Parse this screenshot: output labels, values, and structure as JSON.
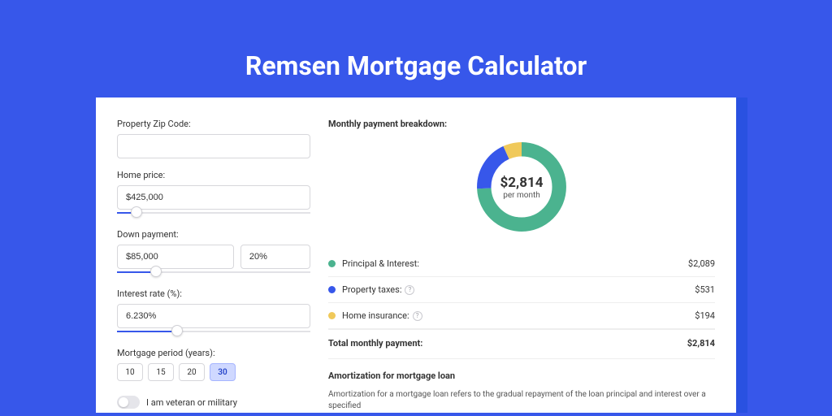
{
  "title": "Remsen Mortgage Calculator",
  "fields": {
    "zip": {
      "label": "Property Zip Code:",
      "value": ""
    },
    "price": {
      "label": "Home price:",
      "value": "$425,000",
      "slider_pct": 10
    },
    "down": {
      "label": "Down payment:",
      "value": "$85,000",
      "pct": "20%",
      "slider_pct": 20
    },
    "rate": {
      "label": "Interest rate (%):",
      "value": "6.230%",
      "slider_pct": 31
    },
    "period": {
      "label": "Mortgage period (years):",
      "options": [
        "10",
        "15",
        "20",
        "30"
      ],
      "selected": "30"
    },
    "military": {
      "label": "I am veteran or military"
    }
  },
  "breakdown": {
    "title": "Monthly payment breakdown:",
    "center_amount": "$2,814",
    "center_sub": "per month",
    "items": [
      {
        "label": "Principal & Interest:",
        "value": "$2,089",
        "color": "#4bb38f",
        "info": false
      },
      {
        "label": "Property taxes:",
        "value": "$531",
        "color": "#3757ea",
        "info": true
      },
      {
        "label": "Home insurance:",
        "value": "$194",
        "color": "#f0c95a",
        "info": true
      }
    ],
    "total": {
      "label": "Total monthly payment:",
      "value": "$2,814"
    }
  },
  "amort": {
    "title": "Amortization for mortgage loan",
    "text": "Amortization for a mortgage loan refers to the gradual repayment of the loan principal and interest over a specified"
  },
  "chart_data": {
    "type": "pie",
    "title": "Monthly payment breakdown",
    "series": [
      {
        "name": "Principal & Interest",
        "value": 2089,
        "color": "#4bb38f"
      },
      {
        "name": "Property taxes",
        "value": 531,
        "color": "#3757ea"
      },
      {
        "name": "Home insurance",
        "value": 194,
        "color": "#f0c95a"
      }
    ],
    "total": 2814,
    "center_label": "$2,814 per month"
  }
}
